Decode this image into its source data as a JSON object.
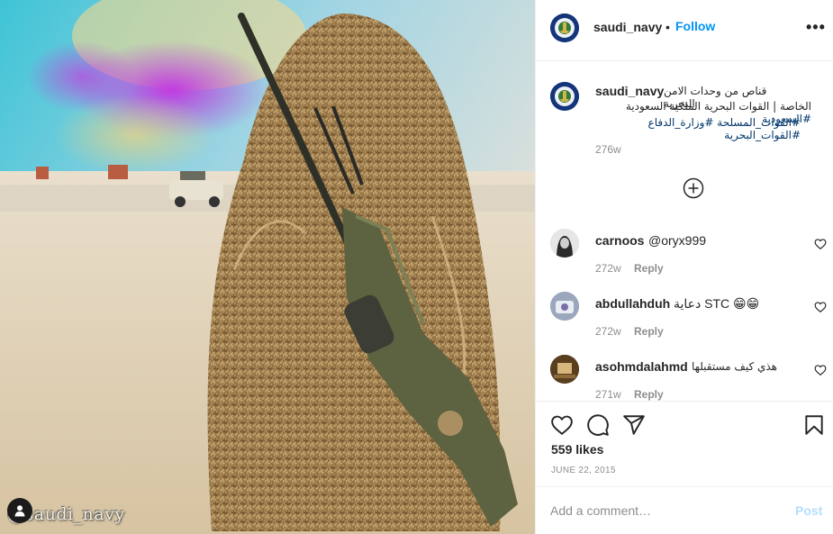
{
  "photo": {
    "watermark": "@saudi_navy",
    "user_tag_icon": "person-icon"
  },
  "header": {
    "username": "saudi_navy",
    "separator": "•",
    "follow_label": "Follow",
    "more_icon": "more-options-icon",
    "more_label": "•••"
  },
  "caption": {
    "username": "saudi_navy",
    "line1": "قناص من وحدات الامن البحرية",
    "line2_text": "الخاصة | القوات البحرية الملكية السعودية ",
    "line2_tag": "#السعودية",
    "line3_tag1": "#القوات_المسلحة",
    "line3_tag2": "#وزارة_الدفاع",
    "line3_tag3": "#القوات_البحرية",
    "time": "276w"
  },
  "load_more_icon": "plus-circle-icon",
  "comments": [
    {
      "username": "carnoos",
      "text": "@oryx999",
      "time": "272w",
      "reply": "Reply"
    },
    {
      "username": "abdullahduh",
      "text": "دعاية STC 😁😁",
      "time": "272w",
      "reply": "Reply"
    },
    {
      "username": "asohmdalahmd",
      "text": "هذي كيف مستقبلها",
      "time": "271w",
      "reply": "Reply"
    }
  ],
  "actions": {
    "like_icon": "heart-icon",
    "comment_icon": "comment-icon",
    "share_icon": "send-icon",
    "save_icon": "bookmark-icon",
    "likes": "559 likes",
    "date": "JUNE 22, 2015"
  },
  "add_comment": {
    "placeholder": "Add a comment…",
    "post_label": "Post"
  },
  "colors": {
    "accent": "#0095f6",
    "hashtag": "#00376b",
    "muted": "#8e8e8e",
    "post_disabled": "#b2dffc"
  }
}
